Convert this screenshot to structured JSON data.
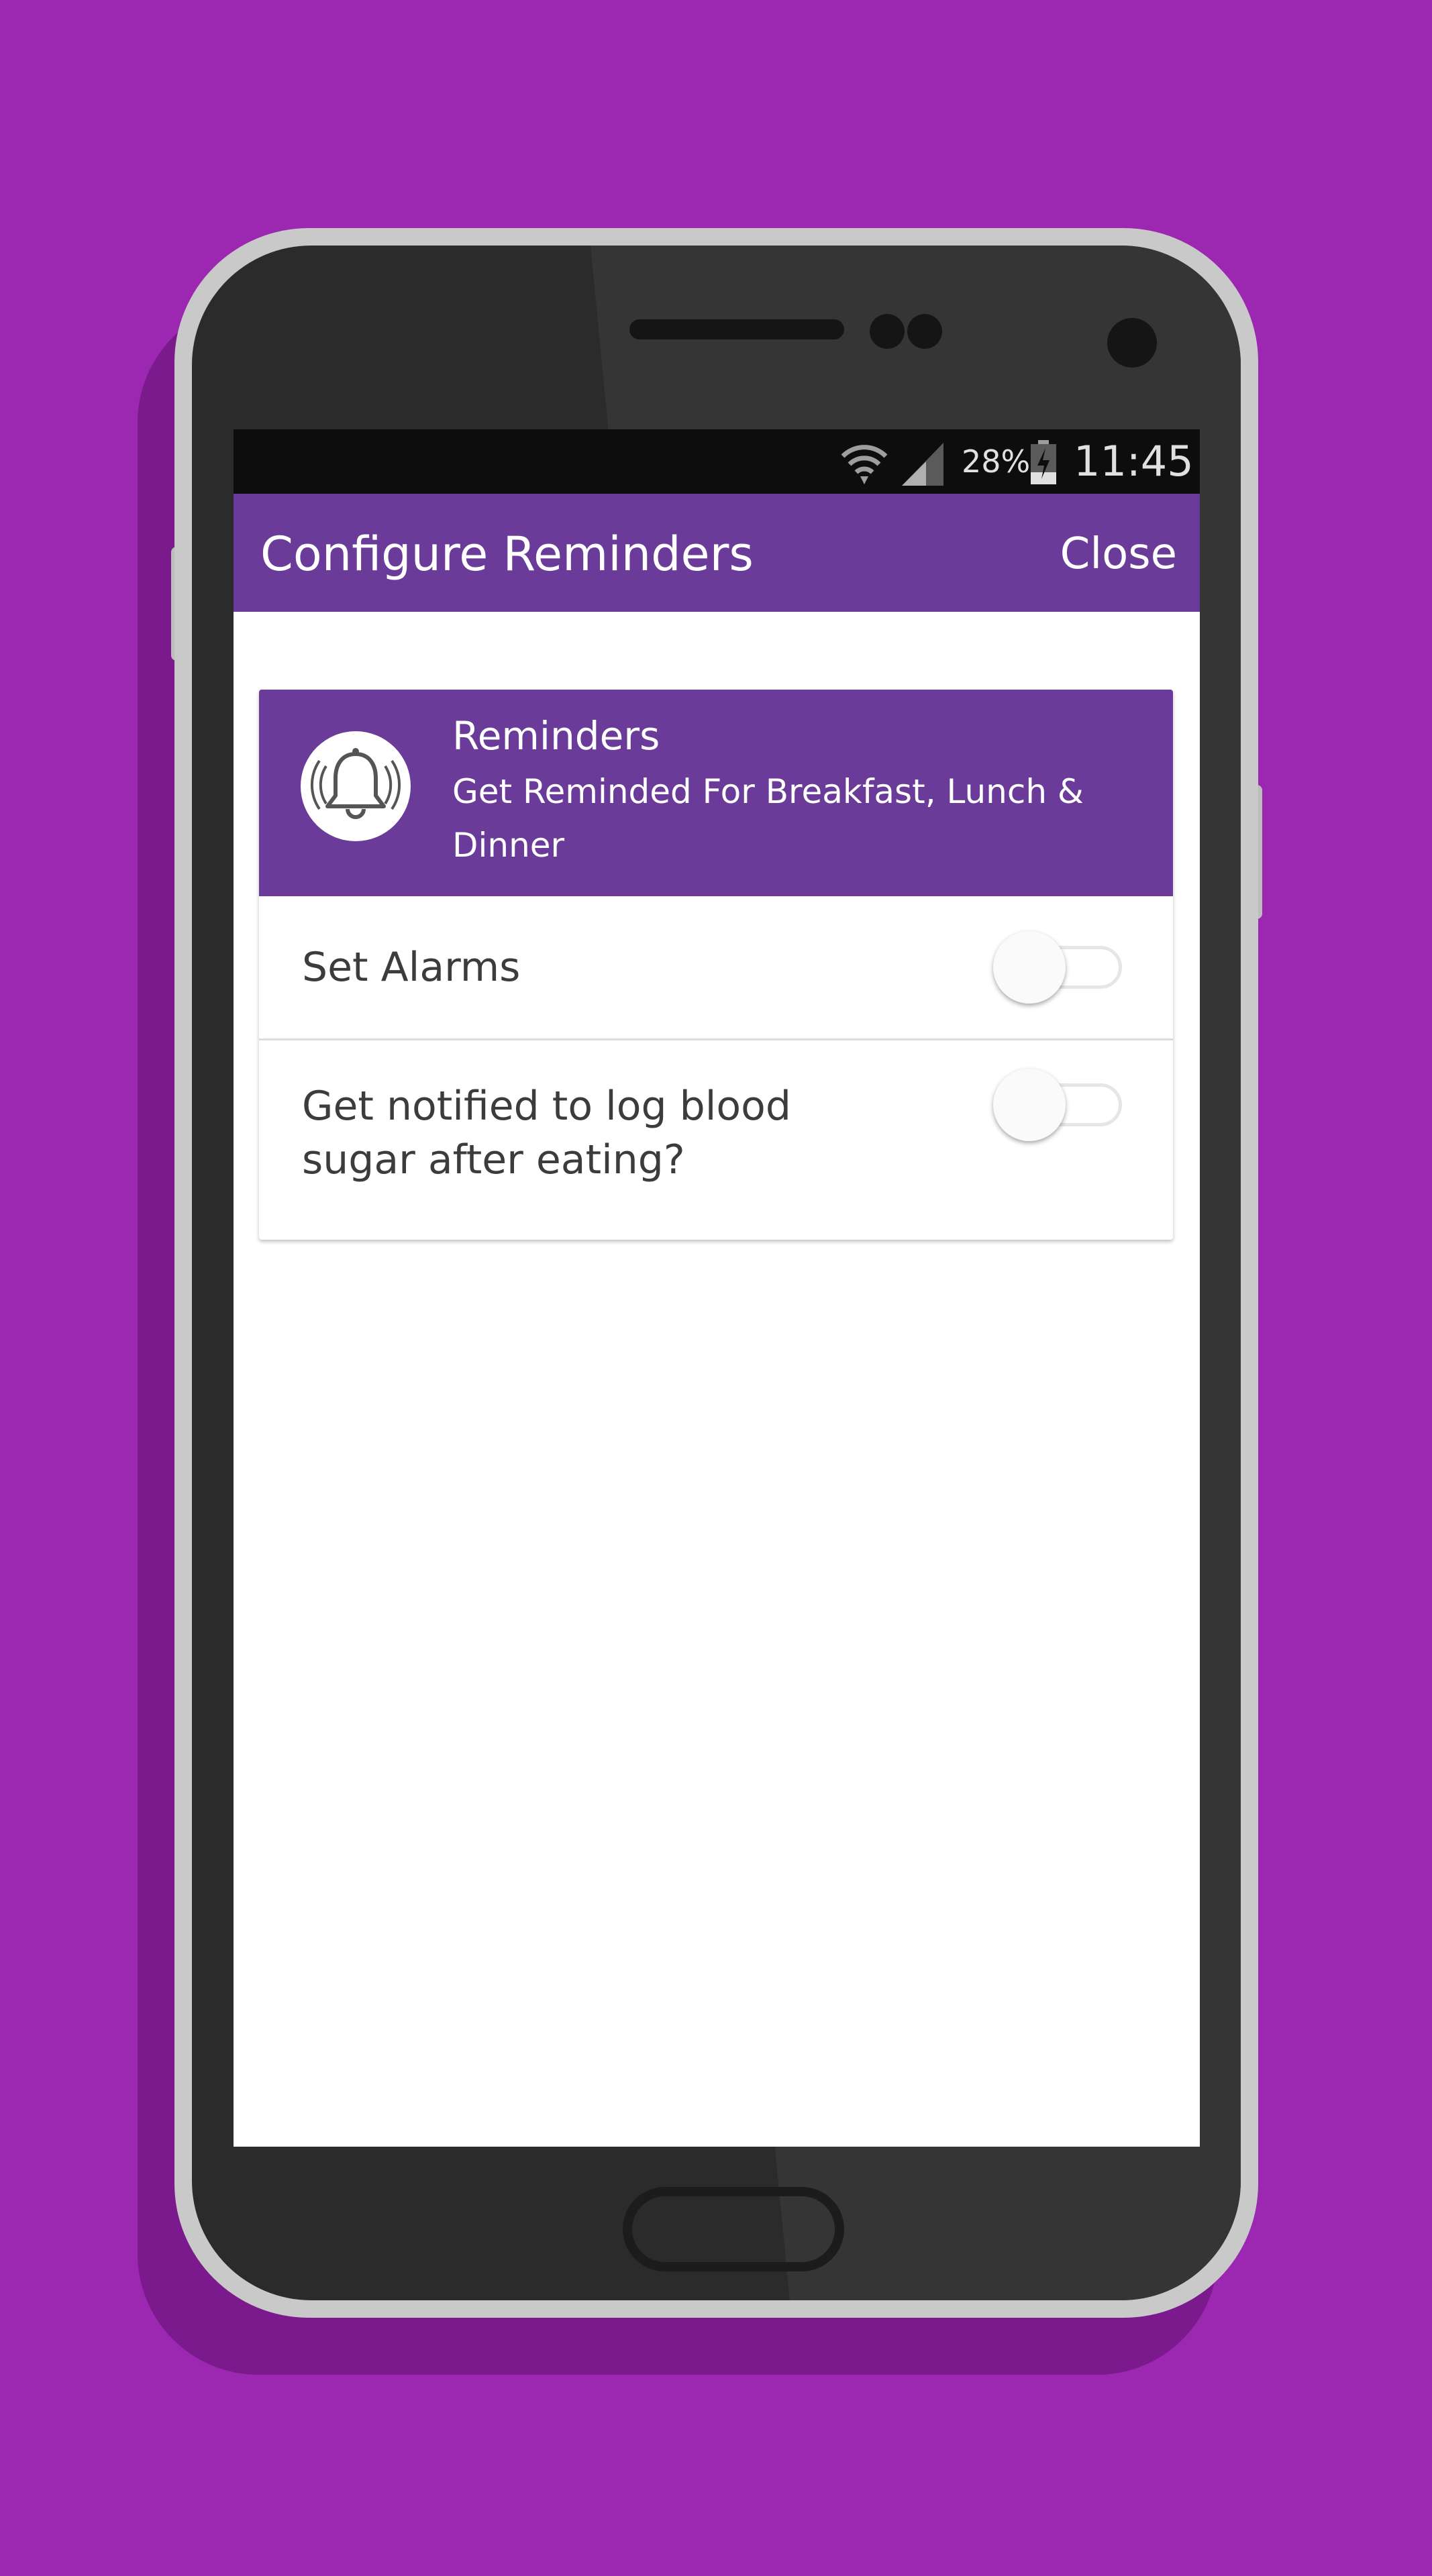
{
  "status_bar": {
    "battery_percent": "28%",
    "time": "11:45",
    "icons": [
      "wifi-icon",
      "cell-signal-icon",
      "battery-charging-icon"
    ]
  },
  "app_bar": {
    "title": "Configure Reminders",
    "close_label": "Close",
    "color": "#6a3b99"
  },
  "reminders_card": {
    "icon": "bell-icon",
    "title": "Reminders",
    "subtitle": "Get Reminded For Breakfast, Lunch & Dinner"
  },
  "settings": [
    {
      "label": "Set Alarms",
      "enabled": false
    },
    {
      "label": "Get notified to log blood sugar after eating?",
      "enabled": false
    }
  ],
  "colors": {
    "background": "#9c27b0",
    "accent": "#6a3b99"
  }
}
